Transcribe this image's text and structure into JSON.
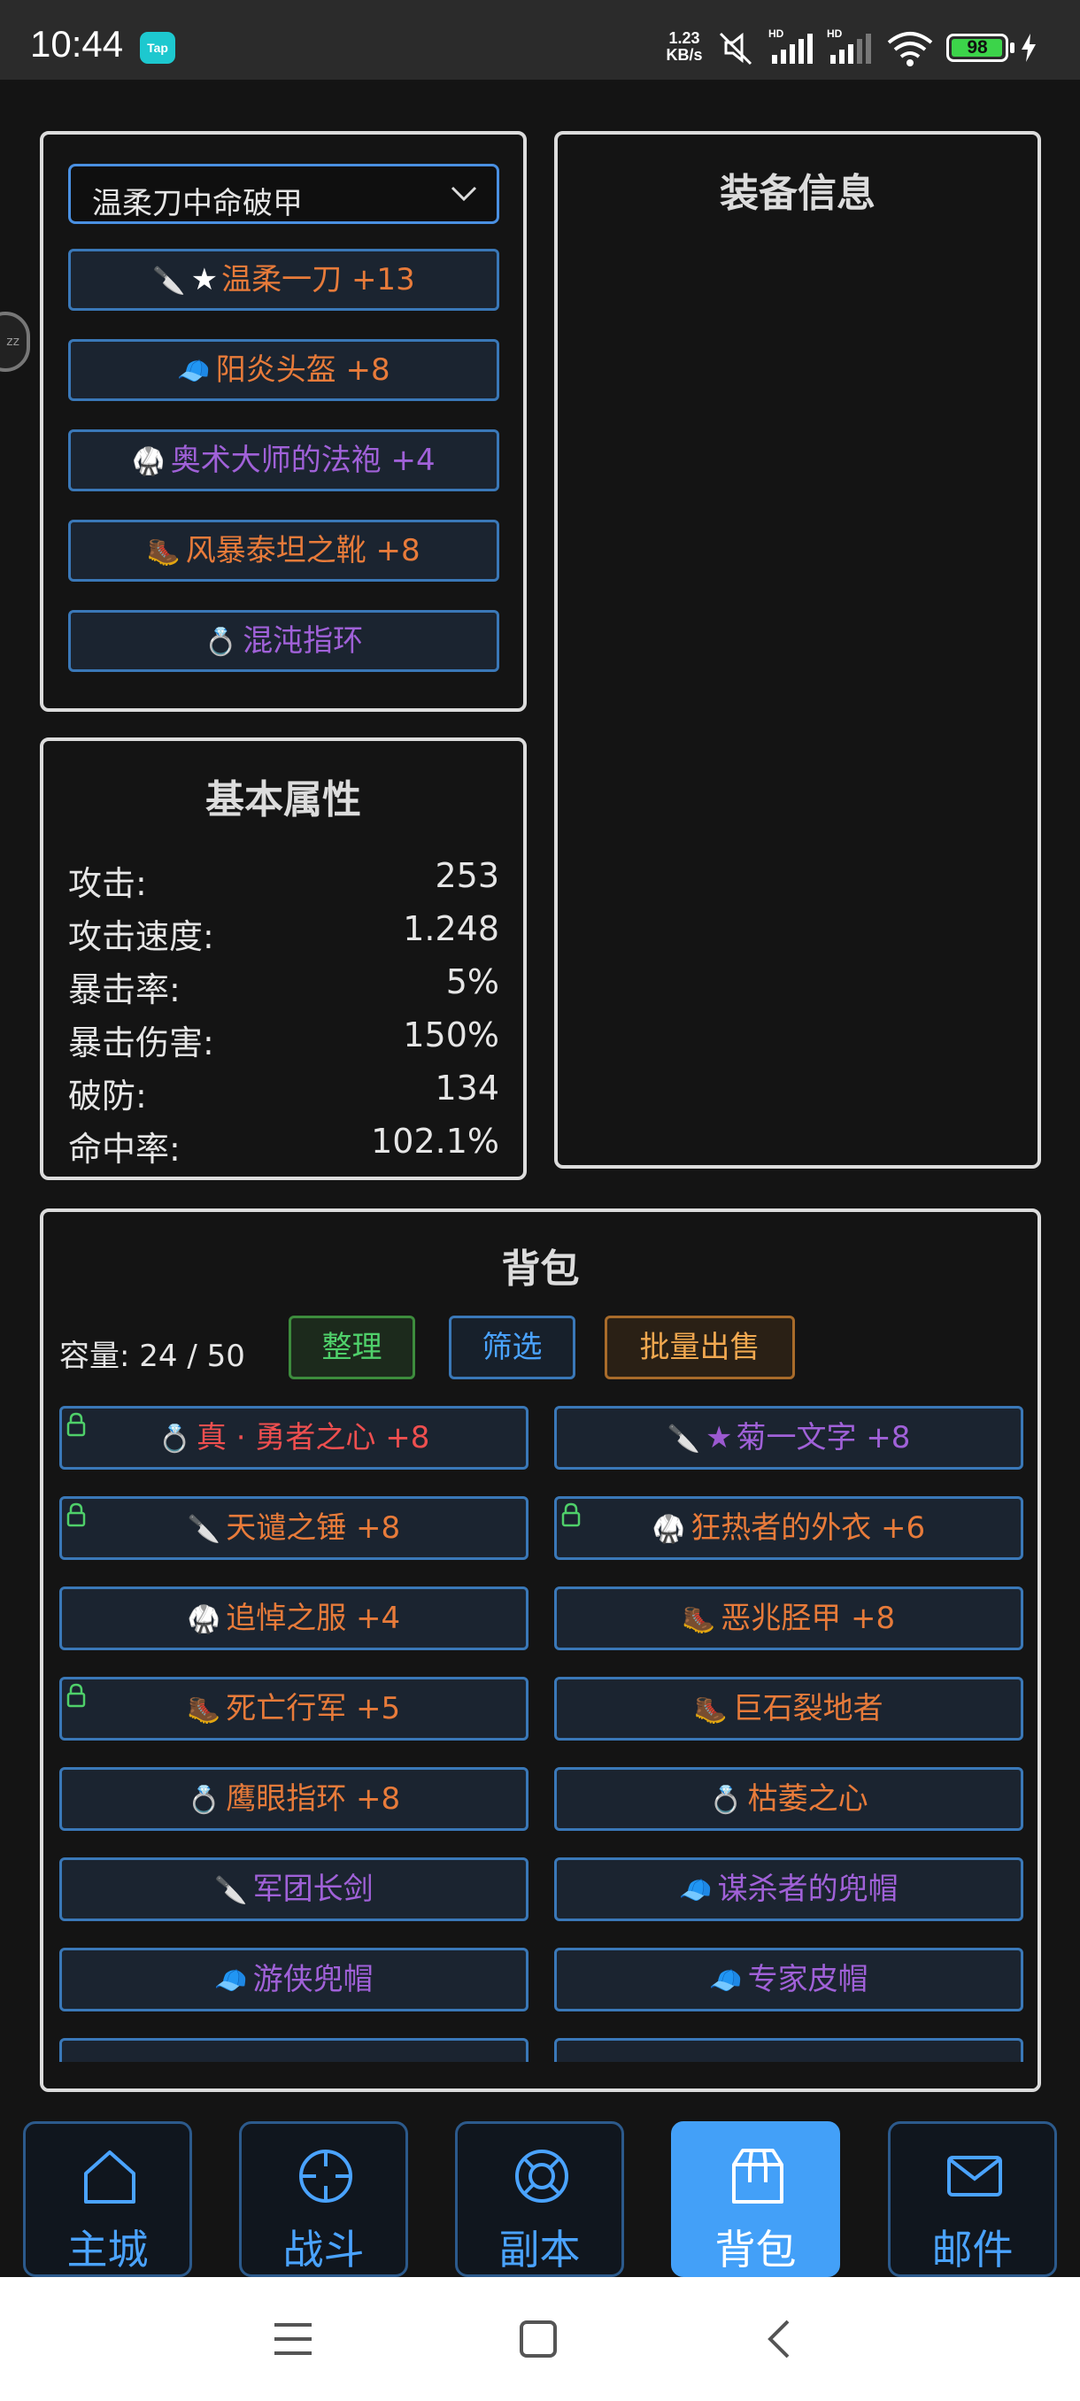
{
  "status_bar": {
    "time": "10:44",
    "app_badge": "Tap",
    "net_speed_value": "1.23",
    "net_speed_unit": "KB/s",
    "battery": "98",
    "battery_level": 0.98,
    "icons": [
      "mute-icon",
      "signal-hd-icon",
      "signal-hd-icon",
      "wifi-icon",
      "battery-icon",
      "charging-icon"
    ]
  },
  "equipment": {
    "preset_selected": "温柔刀中命破甲",
    "slots": [
      {
        "icon": "sword-icon",
        "star": "★",
        "name": "温柔一刀 +13",
        "color": "orange"
      },
      {
        "icon": "helmet-icon",
        "name": "阳炎头盔 +8",
        "color": "orange"
      },
      {
        "icon": "robe-icon",
        "name": "奥术大师的法袍 +4",
        "color": "purple"
      },
      {
        "icon": "boots-icon",
        "name": "风暴泰坦之靴 +8",
        "color": "orange"
      },
      {
        "icon": "ring-icon",
        "name": "混沌指环",
        "color": "purple"
      }
    ]
  },
  "equip_info": {
    "title": "装备信息"
  },
  "stats": {
    "title": "基本属性",
    "rows": [
      {
        "label": "攻击:",
        "value": "253"
      },
      {
        "label": "攻击速度:",
        "value": "1.248"
      },
      {
        "label": "暴击率:",
        "value": "5%"
      },
      {
        "label": "暴击伤害:",
        "value": "150%"
      },
      {
        "label": "破防:",
        "value": "134"
      },
      {
        "label": "命中率:",
        "value": "102.1%"
      }
    ]
  },
  "backpack": {
    "title": "背包",
    "capacity_label": "容量:",
    "capacity_value": "24 / 50",
    "buttons": {
      "sort": "整理",
      "filter": "筛选",
      "bulk_sell": "批量出售"
    },
    "items": [
      {
        "icon": "ring-icon",
        "name": "真 · 勇者之心 +8",
        "color": "red",
        "locked": true
      },
      {
        "icon": "sword-icon",
        "star": "★",
        "name": "菊一文字 +8",
        "color": "purple",
        "locked": false
      },
      {
        "icon": "hammer-icon",
        "name": "天谴之锤 +8",
        "color": "orange",
        "locked": true
      },
      {
        "icon": "robe-icon",
        "name": "狂热者的外衣 +6",
        "color": "orange",
        "locked": true
      },
      {
        "icon": "robe-icon",
        "name": "追悼之服 +4",
        "color": "orange",
        "locked": false
      },
      {
        "icon": "boots-icon",
        "name": "恶兆胫甲 +8",
        "color": "orange",
        "locked": false
      },
      {
        "icon": "boots-icon",
        "name": "死亡行军 +5",
        "color": "orange",
        "locked": true
      },
      {
        "icon": "boots-icon",
        "name": "巨石裂地者",
        "color": "orange",
        "locked": false
      },
      {
        "icon": "ring-icon",
        "name": "鹰眼指环 +8",
        "color": "orange",
        "locked": false
      },
      {
        "icon": "ring-icon",
        "name": "枯萎之心",
        "color": "orange",
        "locked": false
      },
      {
        "icon": "sword-icon",
        "name": "军团长剑",
        "color": "purple",
        "locked": false
      },
      {
        "icon": "helmet-icon",
        "name": "谋杀者的兜帽",
        "color": "purple",
        "locked": false
      },
      {
        "icon": "helmet-icon",
        "name": "游侠兜帽",
        "color": "purple",
        "locked": false
      },
      {
        "icon": "helmet-icon",
        "name": "专家皮帽",
        "color": "purple",
        "locked": false
      }
    ]
  },
  "bottom_nav": {
    "items": [
      {
        "id": "home",
        "label": "主城",
        "icon": "home-icon",
        "active": false
      },
      {
        "id": "battle",
        "label": "战斗",
        "icon": "crosshair-icon",
        "active": false
      },
      {
        "id": "dungeon",
        "label": "副本",
        "icon": "lifebuoy-icon",
        "active": false
      },
      {
        "id": "bag",
        "label": "背包",
        "icon": "package-icon",
        "active": true
      },
      {
        "id": "mail",
        "label": "邮件",
        "icon": "mail-icon",
        "active": false
      }
    ]
  },
  "colors": {
    "accent_blue": "#4aa3ff",
    "active_tab": "#43a0f8",
    "orange_item": "#e87b3a",
    "purple_item": "#a061d8",
    "red_item": "#ef4f4f",
    "green_button": "#4fd06a",
    "gold_button": "#f0a850"
  }
}
